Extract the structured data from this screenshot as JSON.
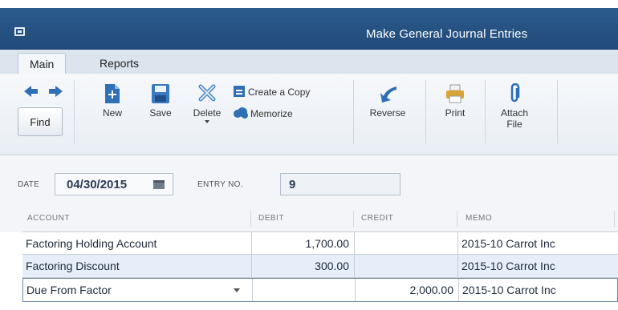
{
  "window": {
    "title": "Make General Journal Entries",
    "icon": "window-menu-icon"
  },
  "tabs": [
    {
      "label": "Main",
      "active": true
    },
    {
      "label": "Reports",
      "active": false
    }
  ],
  "toolbar": {
    "find_label": "Find",
    "new_label": "New",
    "save_label": "Save",
    "delete_label": "Delete",
    "create_copy_label": "Create a Copy",
    "memorize_label": "Memorize",
    "reverse_label": "Reverse",
    "print_label": "Print",
    "attach_label_1": "Attach",
    "attach_label_2": "File"
  },
  "form": {
    "date_label": "DATE",
    "date_value": "04/30/2015",
    "entry_label": "ENTRY NO.",
    "entry_value": "9"
  },
  "table": {
    "headers": {
      "account": "ACCOUNT",
      "debit": "DEBIT",
      "credit": "CREDIT",
      "memo": "MEMO"
    },
    "rows": [
      {
        "account": "Factoring Holding Account",
        "debit": "1,700.00",
        "credit": "",
        "memo": "2015-10 Carrot Inc"
      },
      {
        "account": "Factoring Discount",
        "debit": "300.00",
        "credit": "",
        "memo": "2015-10 Carrot Inc"
      },
      {
        "account": "Due From Factor",
        "debit": "",
        "credit": "2,000.00",
        "memo": "2015-10 Carrot Inc"
      }
    ]
  },
  "colors": {
    "titlebar": "#2b5b8e",
    "selected_row": "#e5eef9",
    "accent_blue": "#2f6fb5"
  }
}
